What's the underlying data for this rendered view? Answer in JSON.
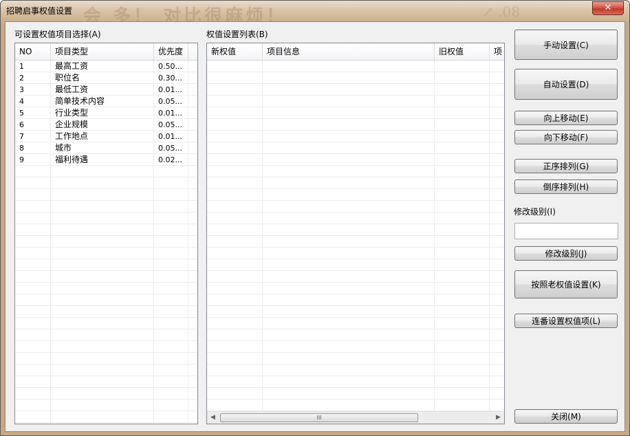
{
  "window": {
    "title": "招聘启事权值设置",
    "close_glyph": "✕",
    "background_text": "会 多！ 对比很麻烦！",
    "background_text_2": "↗ .08"
  },
  "left_panel": {
    "label": "可设置权值项目选择(A)",
    "columns": [
      "NO",
      "项目类型",
      "优先度"
    ],
    "rows": [
      {
        "no": "1",
        "type": "最高工资",
        "priority": "0.50..."
      },
      {
        "no": "2",
        "type": "职位名",
        "priority": "0.30..."
      },
      {
        "no": "3",
        "type": "最低工资",
        "priority": "0.01..."
      },
      {
        "no": "4",
        "type": "简单技术内容",
        "priority": "0.05..."
      },
      {
        "no": "5",
        "type": "行业类型",
        "priority": "0.01..."
      },
      {
        "no": "6",
        "type": "企业规模",
        "priority": "0.05..."
      },
      {
        "no": "7",
        "type": "工作地点",
        "priority": "0.01..."
      },
      {
        "no": "8",
        "type": "城市",
        "priority": "0.05..."
      },
      {
        "no": "9",
        "type": "福利待遇",
        "priority": "0.02..."
      }
    ]
  },
  "right_panel": {
    "label": "权值设置列表(B)",
    "columns": [
      "新权值",
      "项目信息",
      "旧权值",
      "项"
    ],
    "scroll_grip": "III",
    "scroll_left": "◀",
    "scroll_right": "▶"
  },
  "buttons": {
    "manual": "手动设置(C)",
    "auto": "自动设置(D)",
    "move_up": "向上移动(E)",
    "move_down": "向下移动(F)",
    "sort_asc": "正序排列(G)",
    "sort_desc": "倒序排列(H)",
    "modify_level_label": "修改级别(I)",
    "modify_level_value": "",
    "modify_level": "修改级别(J)",
    "old_weight": "按照老权值设置(K)",
    "batch": "连番设置权值项(L)",
    "close": "关闭(M)"
  }
}
